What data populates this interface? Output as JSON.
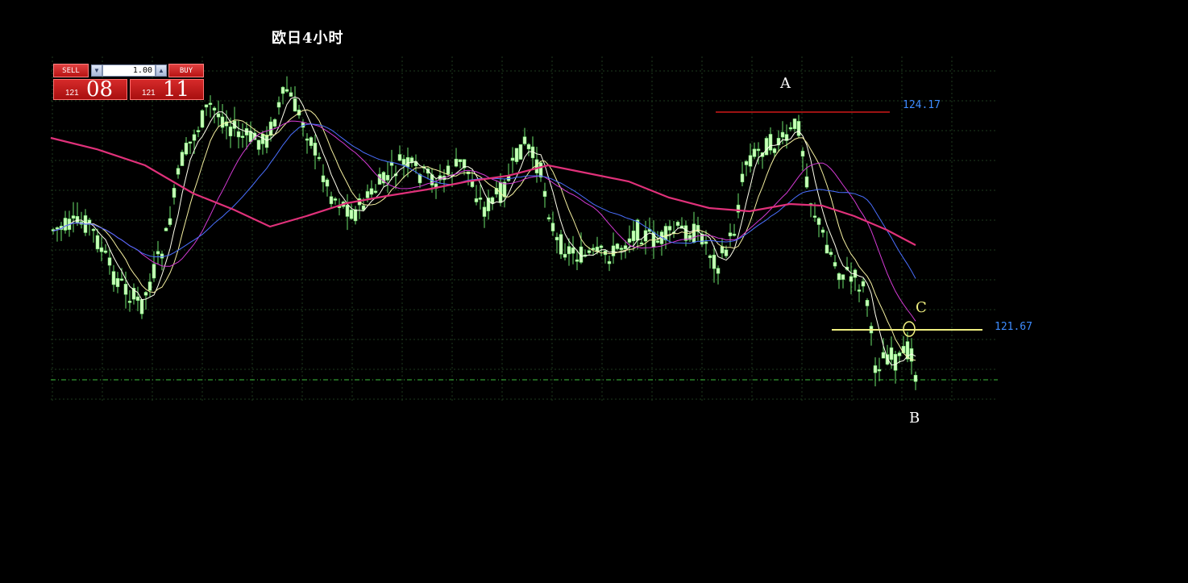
{
  "title": "欧日4小时",
  "trade_panel": {
    "sell_label": "SELL",
    "buy_label": "BUY",
    "lot_value": "1.00",
    "sell_price_prefix": "121",
    "sell_price_big": "08",
    "buy_price_prefix": "121",
    "buy_price_big": "11",
    "spin_down_icon": "chevron-down-icon",
    "spin_up_icon": "chevron-up-icon"
  },
  "annotations": {
    "a": "A",
    "b": "B",
    "c": "C"
  },
  "levels": {
    "top": "124.17",
    "bottom": "121.67"
  },
  "colors": {
    "background": "#000000",
    "candle": "#c8ffb8",
    "wick": "#6be36b",
    "grid": "#1e3a1e",
    "ma_white": "#ffffee",
    "ma_blue": "#4a6fff",
    "ma_magenta": "#d43ad4",
    "ma_pink": "#e0317a",
    "line_red": "#d01818",
    "line_yellow": "#f0f080",
    "label_blue": "#3e8cff"
  }
}
